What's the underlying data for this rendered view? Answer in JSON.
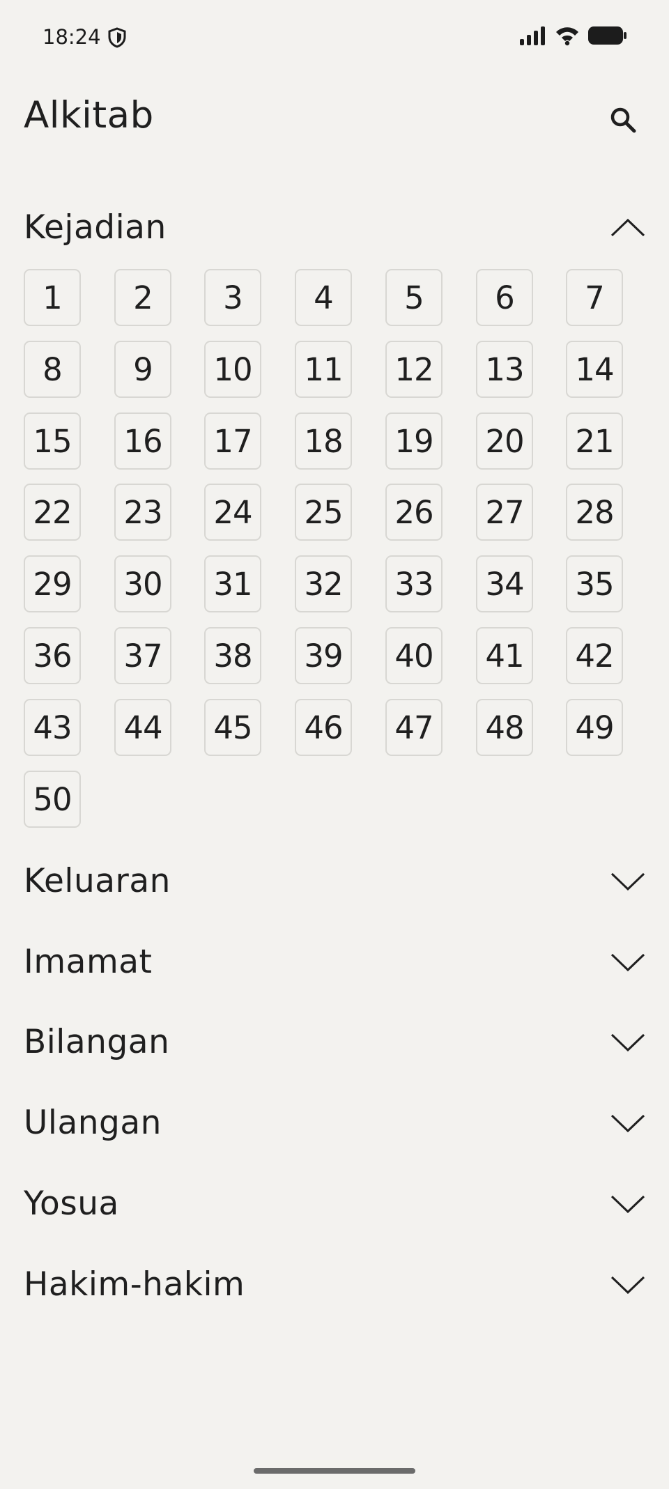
{
  "status_bar": {
    "time": "18:24"
  },
  "app_bar": {
    "title": "Alkitab",
    "search_icon": "search-icon"
  },
  "books": [
    {
      "name": "Kejadian",
      "expanded": true,
      "chapters": [
        "1",
        "2",
        "3",
        "4",
        "5",
        "6",
        "7",
        "8",
        "9",
        "10",
        "11",
        "12",
        "13",
        "14",
        "15",
        "16",
        "17",
        "18",
        "19",
        "20",
        "21",
        "22",
        "23",
        "24",
        "25",
        "26",
        "27",
        "28",
        "29",
        "30",
        "31",
        "32",
        "33",
        "34",
        "35",
        "36",
        "37",
        "38",
        "39",
        "40",
        "41",
        "42",
        "43",
        "44",
        "45",
        "46",
        "47",
        "48",
        "49",
        "50"
      ]
    },
    {
      "name": "Keluaran",
      "expanded": false
    },
    {
      "name": "Imamat",
      "expanded": false
    },
    {
      "name": "Bilangan",
      "expanded": false
    },
    {
      "name": "Ulangan",
      "expanded": false
    },
    {
      "name": "Yosua",
      "expanded": false
    },
    {
      "name": "Hakim-hakim",
      "expanded": false
    }
  ],
  "colors": {
    "background": "#f3f2ef",
    "text": "#1f1f1f",
    "cell_border": "#d8d7d3"
  }
}
